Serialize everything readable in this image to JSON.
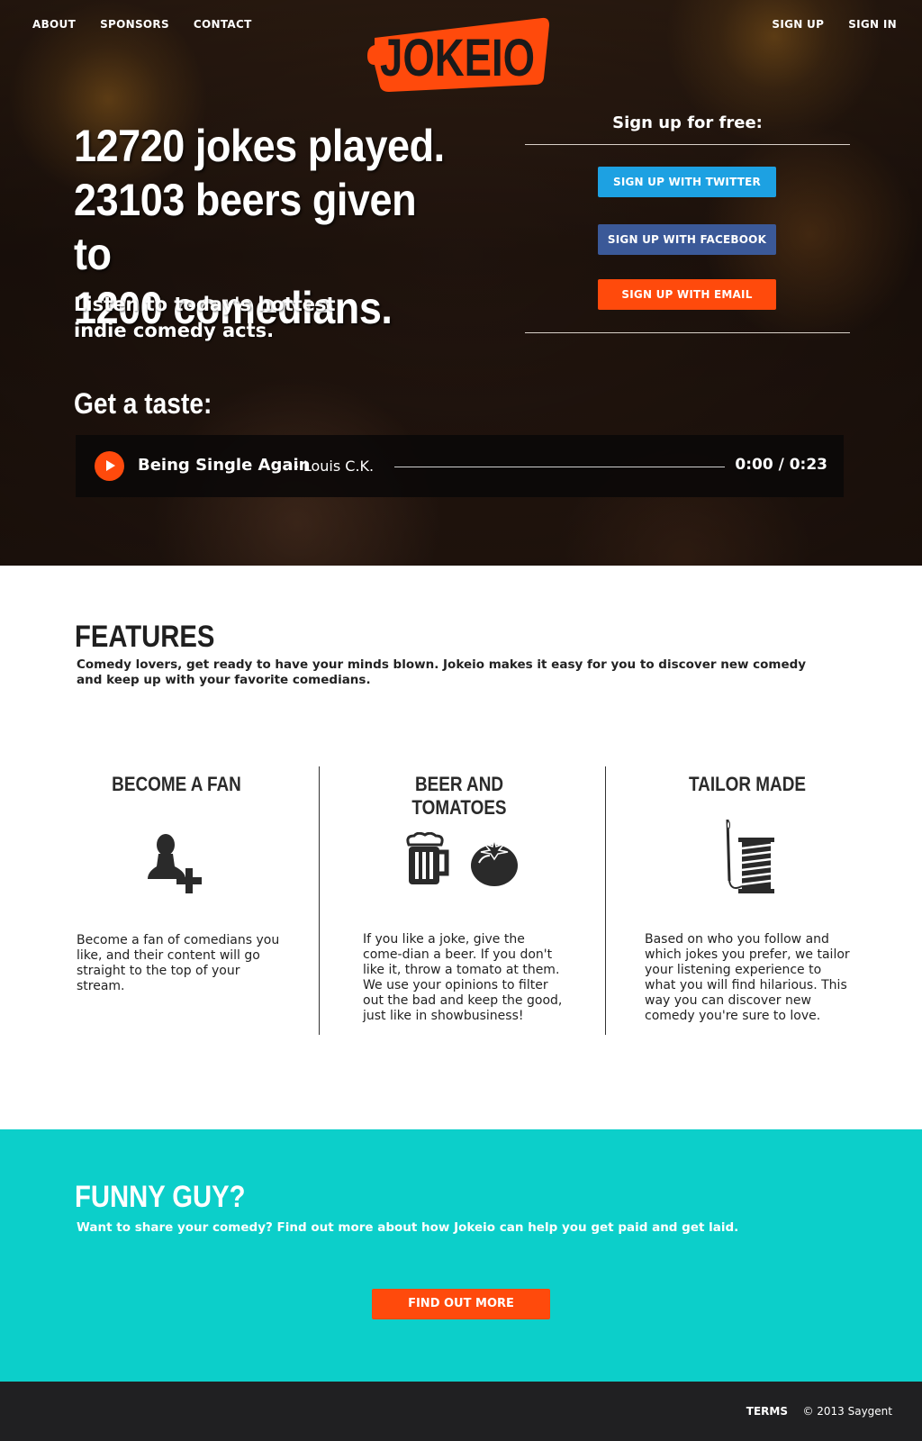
{
  "nav": {
    "left": [
      "ABOUT",
      "SPONSORS",
      "CONTACT"
    ],
    "right": [
      "SIGN UP",
      "SIGN IN"
    ]
  },
  "logo": {
    "text": "JOKEIO",
    "color": "#ff4a0c"
  },
  "hero": {
    "headline_lines": [
      "12720 jokes played.",
      "23103 beers given to",
      "1200 comedians."
    ],
    "subline": "Listen to today's hottest indie comedy acts."
  },
  "signup": {
    "title": "Sign up for free:",
    "twitter_label": "SIGN UP WITH TWITTER",
    "facebook_label": "SIGN UP WITH FACEBOOK",
    "email_label": "SIGN UP WITH EMAIL"
  },
  "taste": {
    "title": "Get a taste:",
    "track_title": "Being Single Again",
    "track_artist": "- Louis C.K.",
    "time": "0:00 / 0:23",
    "progress": 0
  },
  "features": {
    "title": "FEATURES",
    "intro": "Comedy lovers, get ready to have your minds blown. Jokeio makes it easy for you to discover new comedy and keep up with your favorite comedians.",
    "items": [
      {
        "title": "BECOME A FAN",
        "icon": "add-user-icon",
        "text": "Become a fan of comedians you like, and their content will go straight to the top of your stream."
      },
      {
        "title": "BEER AND TOMATOES",
        "icon": "beer-mug-icon, tomato-icon",
        "text": "If you like a joke, give the come-dian a beer. If you don't like it, throw a tomato at them. We use your opinions to filter out the bad and keep the good, just like in showbusiness!"
      },
      {
        "title": "TAILOR MADE",
        "icon": "thread-spool-icon",
        "text": "Based on who you follow and which jokes you prefer, we tailor your listening experience to what you will find hilarious. This way you can discover new comedy you're sure to love."
      }
    ]
  },
  "cta": {
    "title": "FUNNY GUY?",
    "text": "Want to share your comedy? Find out more about how Jokeio can help you get paid and get laid.",
    "button_label": "FIND OUT MORE",
    "color": "#0ccfca"
  },
  "footer": {
    "terms": "TERMS",
    "copyright": "© 2013 Saygent"
  }
}
